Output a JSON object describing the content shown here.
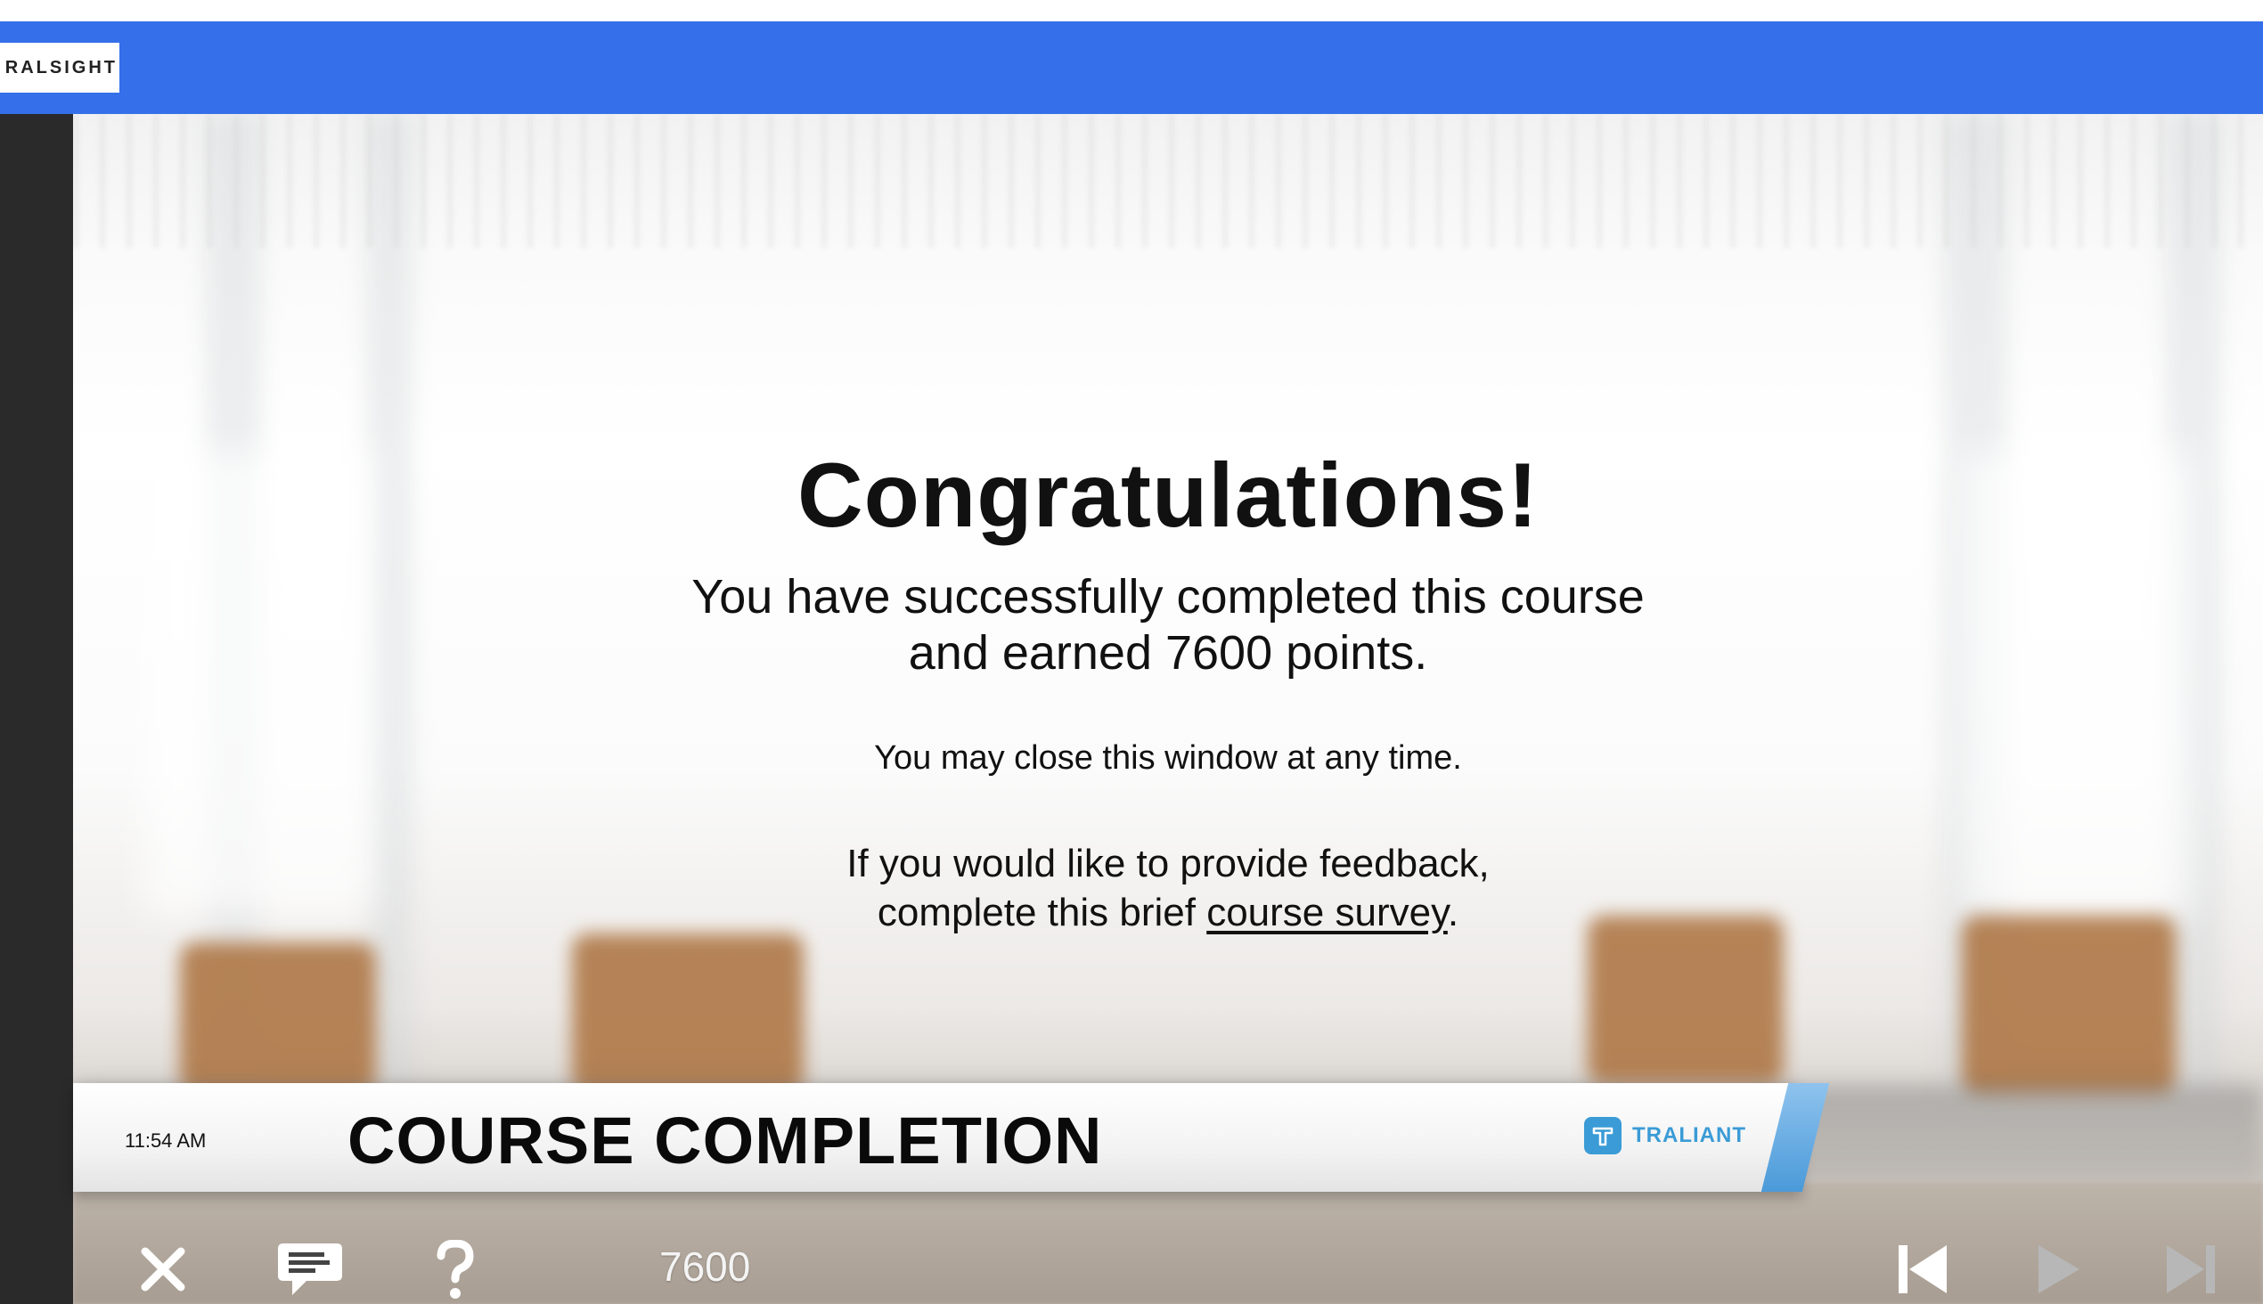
{
  "app": {
    "logo_text": "RALSIGHT"
  },
  "message": {
    "heading": "Congratulations!",
    "line1": "You have successfully completed this course",
    "line2": "and earned 7600 points.",
    "line3": "You may close this window at any time.",
    "line4": "If you would like to provide feedback,",
    "line5_prefix": "complete this brief ",
    "survey_link": "course survey",
    "line5_suffix": "."
  },
  "banner": {
    "time": "11:54 AM",
    "title": "COURSE COMPLETION",
    "brand": "TRALIANT"
  },
  "controls": {
    "score": "7600",
    "close_icon": "close-icon",
    "comment_icon": "comment-icon",
    "help_icon": "help-icon",
    "prev_icon": "skip-back-icon",
    "play_icon": "play-icon",
    "next_icon": "skip-forward-icon"
  },
  "colors": {
    "topbar": "#356fea",
    "brand": "#3a9bd6",
    "left_strip": "#2a2a2a"
  }
}
